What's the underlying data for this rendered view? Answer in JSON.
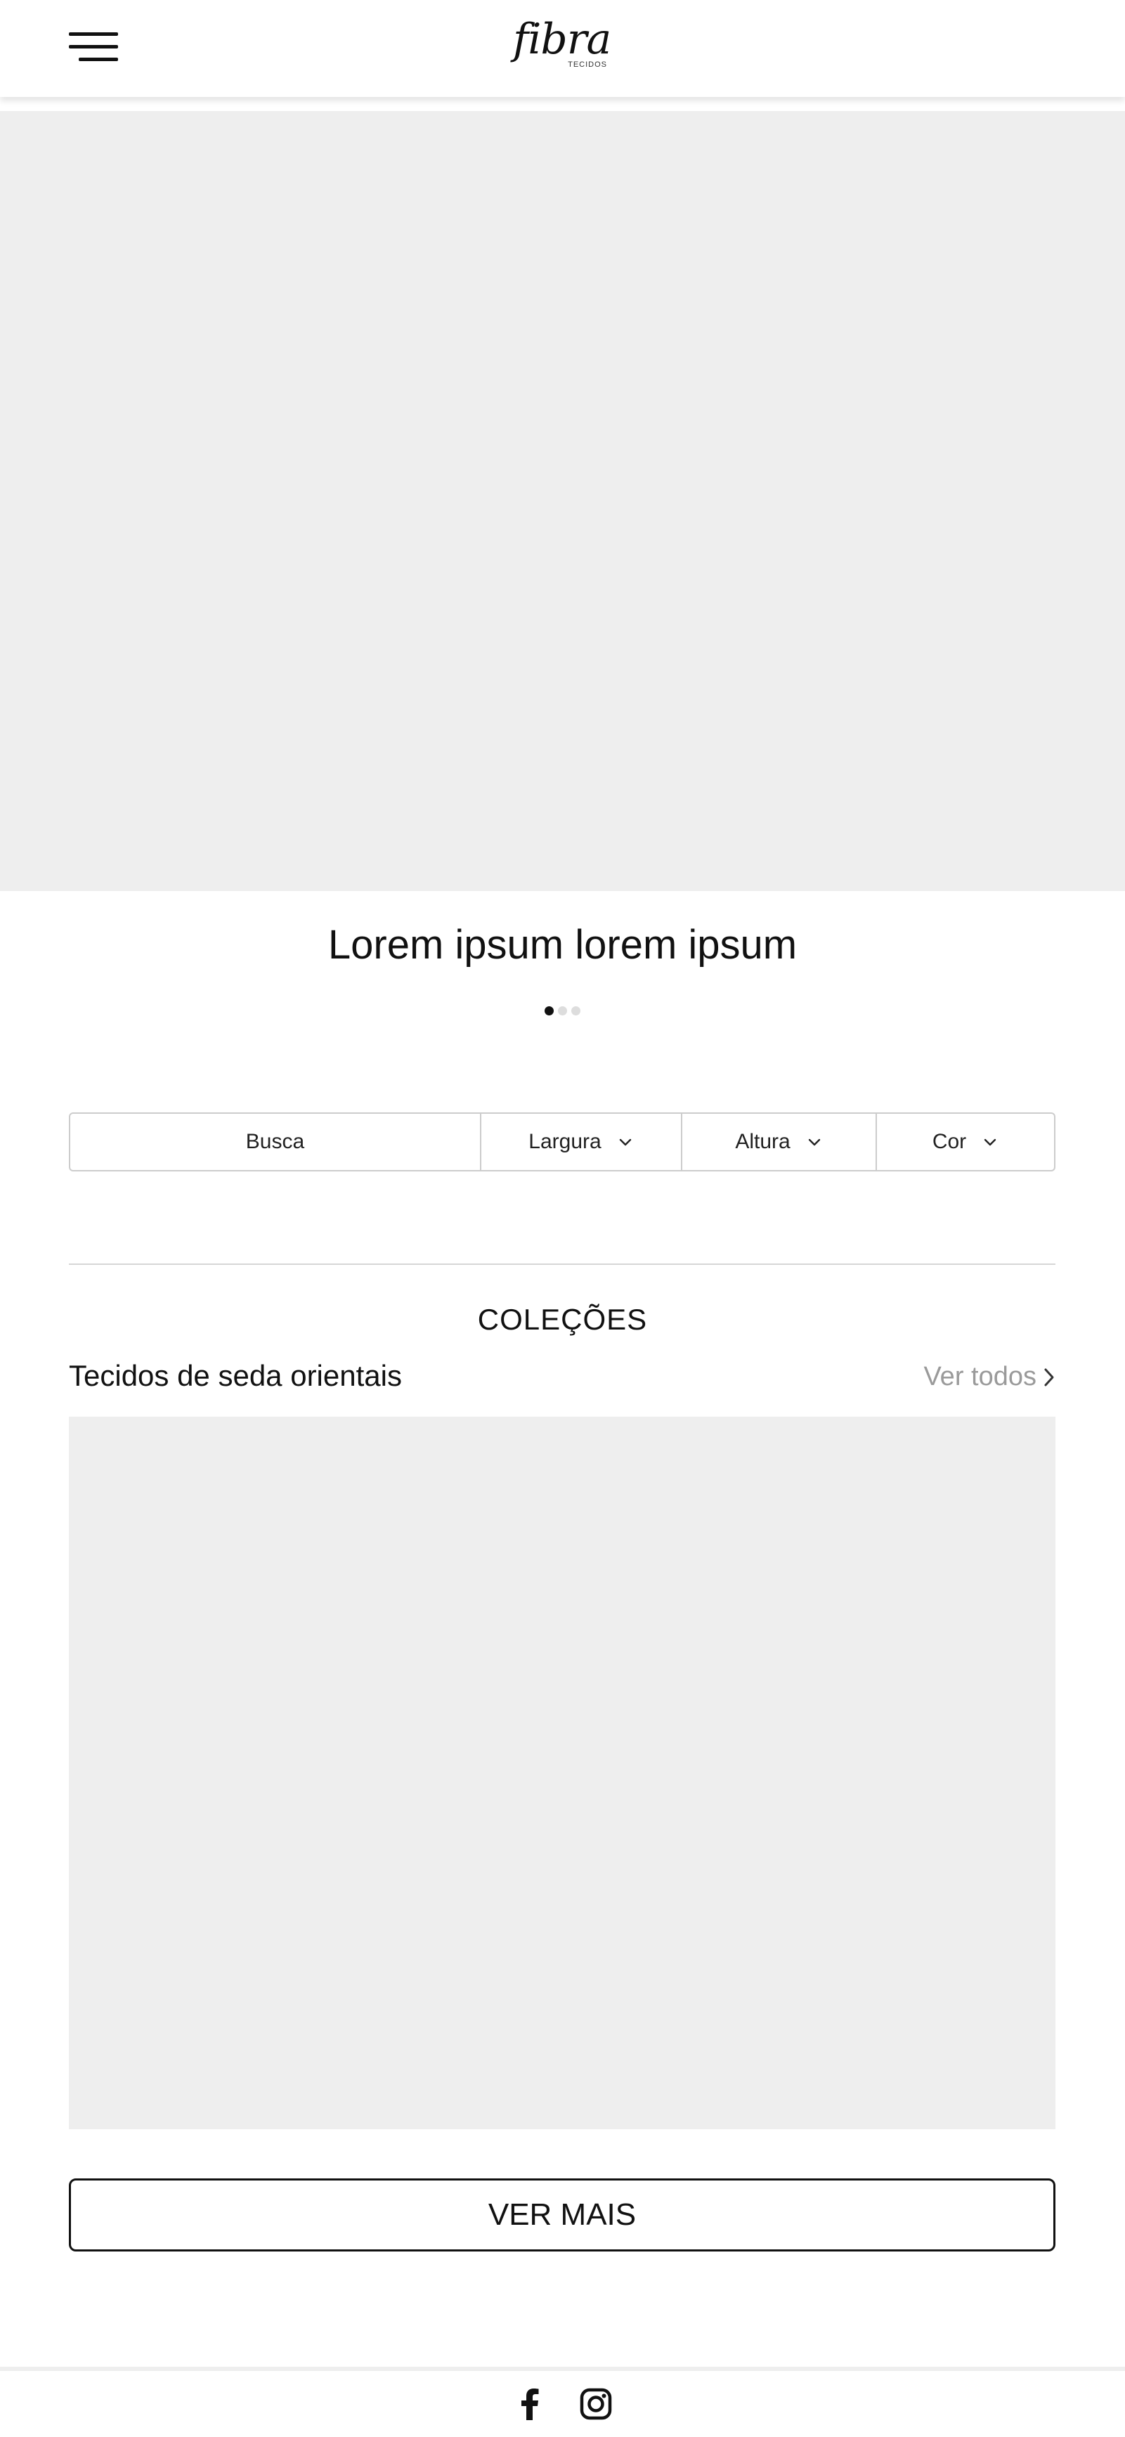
{
  "header": {
    "menu_icon": "hamburger-menu-icon",
    "logo_text": "fibra",
    "logo_subtext": "TECIDOS"
  },
  "hero": {
    "title": "Lorem ipsum lorem ipsum",
    "slides_total": 3,
    "active_slide": 1
  },
  "filters": {
    "search_placeholder": "Busca",
    "width_label": "Largura",
    "height_label": "Altura",
    "color_label": "Cor",
    "dropdown_icon": "chevron-down-icon"
  },
  "collections": {
    "section_title": "COLEÇÕES",
    "collection_name": "Tecidos de seda orientais",
    "see_all_label": "Ver todos",
    "see_all_icon": "chevron-right-icon",
    "more_button_label": "VER MAIS"
  },
  "footer": {
    "social_icons": [
      "facebook-icon",
      "instagram-icon"
    ]
  },
  "colors": {
    "placeholder_bg": "#eeeeee",
    "border": "#cccccc",
    "muted_text": "#9a9a9a",
    "text": "#111111"
  }
}
